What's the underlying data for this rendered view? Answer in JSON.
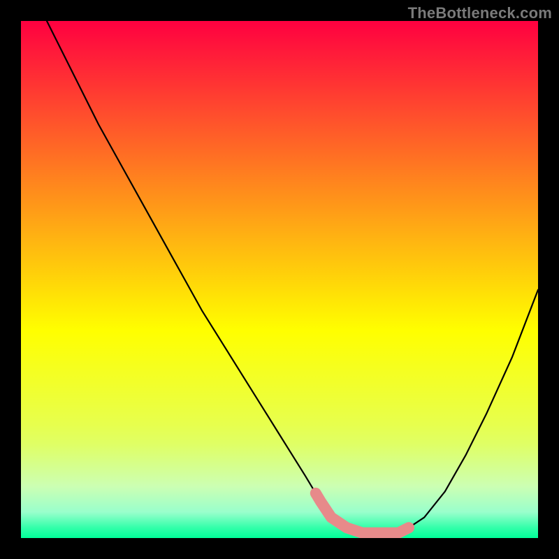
{
  "watermark": "TheBottleneck.com",
  "colors": {
    "frame": "#000000",
    "curve": "#000000",
    "optimal_marker": "#e78a8a",
    "gradient_top": "#ff0040",
    "gradient_mid": "#ffff00",
    "gradient_bottom": "#00ff99"
  },
  "chart_data": {
    "type": "line",
    "title": "",
    "xlabel": "",
    "ylabel": "",
    "xlim": [
      0,
      100
    ],
    "ylim": [
      0,
      100
    ],
    "grid": false,
    "legend_position": "none",
    "series": [
      {
        "name": "bottleneck-curve",
        "x": [
          5,
          10,
          15,
          20,
          25,
          30,
          35,
          40,
          45,
          50,
          55,
          58,
          60,
          63,
          66,
          70,
          73,
          75,
          78,
          82,
          86,
          90,
          95,
          100
        ],
        "values": [
          100,
          90,
          80,
          71,
          62,
          53,
          44,
          36,
          28,
          20,
          12,
          7,
          4,
          2,
          1,
          1,
          1,
          2,
          4,
          9,
          16,
          24,
          35,
          48
        ]
      }
    ],
    "annotations": [
      {
        "name": "optimal-range",
        "x_start": 57,
        "x_end": 75,
        "style": "thick-rounded-highlight"
      }
    ]
  }
}
